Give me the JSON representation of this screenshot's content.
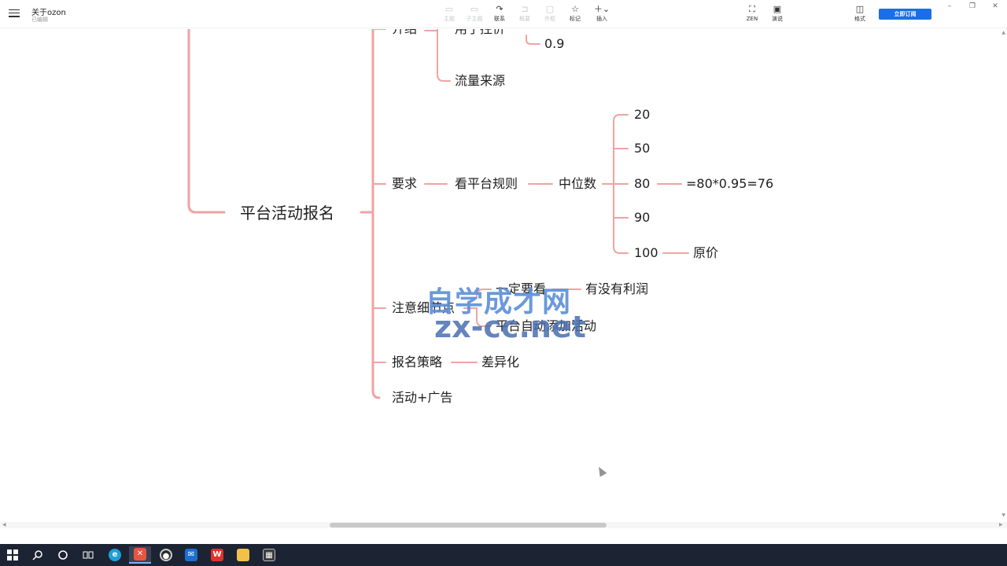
{
  "window": {
    "title": "关于ozon",
    "status": "已编辑"
  },
  "toolbar": {
    "items": [
      {
        "label": "主题",
        "icon": "topic-icon",
        "enabled": false
      },
      {
        "label": "子主题",
        "icon": "subtopic-icon",
        "enabled": false
      },
      {
        "label": "联系",
        "icon": "relation-icon",
        "enabled": true
      },
      {
        "label": "概要",
        "icon": "summary-icon",
        "enabled": false
      },
      {
        "label": "外框",
        "icon": "boundary-icon",
        "enabled": false
      },
      {
        "label": "标记",
        "icon": "marker-star-icon",
        "enabled": true
      },
      {
        "label": "插入",
        "icon": "insert-plus-icon",
        "enabled": true
      }
    ],
    "zen_label": "ZEN",
    "present_label": "演说",
    "format_label": "格式",
    "subscribe_label": "立即订阅"
  },
  "mindmap": {
    "root": "平台活动报名",
    "branches": {
      "intro": "介绍",
      "intro_child": "用于控价",
      "intro_value": "0.9",
      "traffic": "流量来源",
      "requirement": "要求",
      "rules": "看平台规则",
      "median": "中位数",
      "values": [
        "20",
        "50",
        "80",
        "90",
        "100"
      ],
      "formula": "=80*0.95=76",
      "original_price": "原价",
      "notes": "注意细节点",
      "must_check": "一定要看",
      "profit": "有没有利润",
      "auto_add": "平台自动添加活动",
      "strategy": "报名策略",
      "differentiation": "差异化",
      "activity_ads": "活动+广告"
    }
  },
  "watermark": {
    "line1": "自学成才网",
    "line2": "zx-cc.net"
  },
  "colors": {
    "branch_line": "#efa3a3",
    "accent": "#1a6fe6",
    "taskbar": "#1c2433"
  }
}
